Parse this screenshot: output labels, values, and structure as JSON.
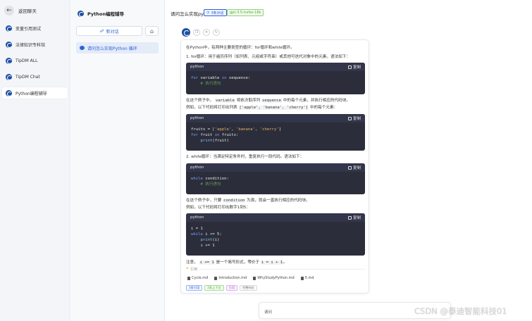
{
  "nav": {
    "back_label": "返回聊天",
    "items": [
      "变量引用测试",
      "法律知识专科馆",
      "TipDM ALL",
      "TipDM Chat",
      "Python编程辅导"
    ],
    "active_index": 4
  },
  "conversation": {
    "app_title": "Python编程辅导",
    "new_chat_label": "新对话",
    "items": [
      "请问怎么实现Python 循环"
    ]
  },
  "header": {
    "title": "请问怎么实现py",
    "time_badge": "3条对话",
    "model_badge": "gpt-3.5-turbo-16k"
  },
  "answer": {
    "intro": "在Python中，有两种主要类型的循环：for循环和while循环。",
    "p1": "1. for循环：用于遍历序列（如列表、元组或字符串）或其他可迭代对象中的元素。语法如下：",
    "p2a": "在这个例子中，",
    "p2code1": "variable",
    "p2b": "将依次取序列",
    "p2code2": "sequence",
    "p2c": "中的每个元素，并执行相应的代码块。",
    "p3a": "例如，以下代码将打印出列表",
    "p3code1": "['apple', 'banana', 'cherry']",
    "p3b": "中的每个元素：",
    "p4": "2. while循环：当满足特定条件时，重复执行一段代码。语法如下：",
    "p5a": "在这个例子中，只要",
    "p5code1": "condition",
    "p5b": "为真，就会一直执行相应的代码块。",
    "p6": "例如，以下代码将打印出数字1到5：",
    "p7a": "注意，",
    "p7code1": "i += 1",
    "p7b": "是一个简写形式，等价于",
    "p7code2": "i = i + 1",
    "p7c": "。",
    "code_lang": "python",
    "copy_label": "复制",
    "refs_label": "引用",
    "refs": [
      "Cycle.md",
      "Introduction.md",
      "WhyStudyPython.md",
      "5.md"
    ],
    "tags": [
      "3条引用",
      "2条上下文",
      "引用",
      "完整响应"
    ]
  },
  "input": {
    "placeholder": "请问"
  },
  "watermark": "CSDN @泰迪智能科技01"
}
